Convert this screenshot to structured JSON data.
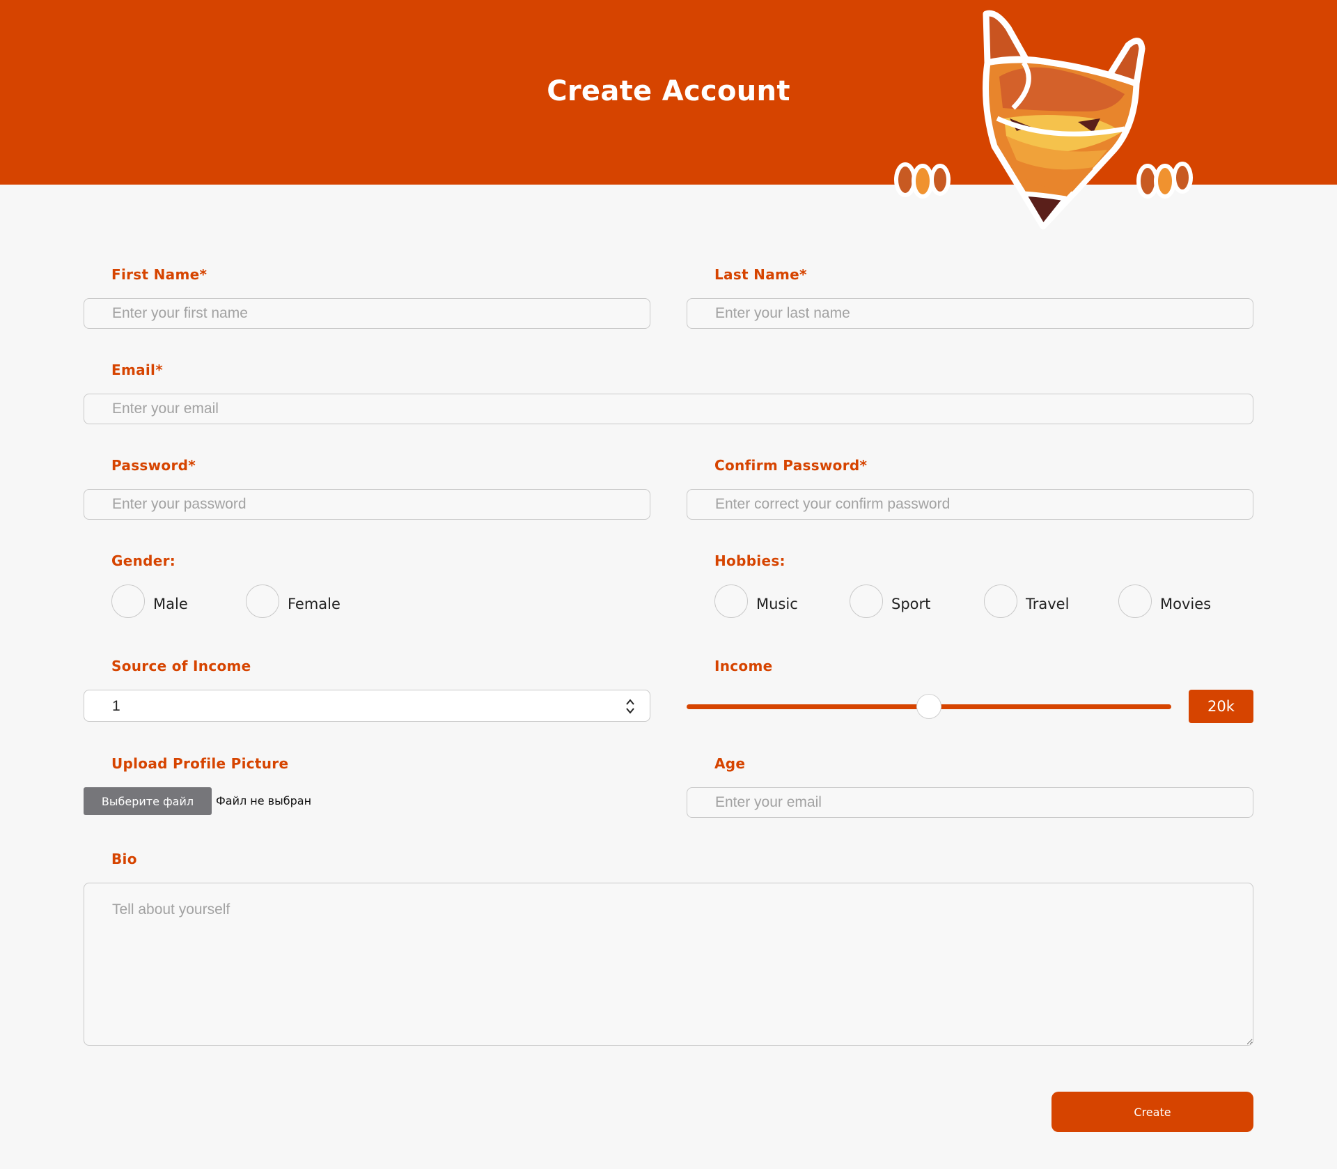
{
  "header": {
    "title": "Create Account"
  },
  "form": {
    "first_name": {
      "label": "First Name*",
      "placeholder": "Enter your first name"
    },
    "last_name": {
      "label": "Last Name*",
      "placeholder": "Enter your last name"
    },
    "email": {
      "label": "Email*",
      "placeholder": "Enter your email"
    },
    "password": {
      "label": "Password*",
      "placeholder": "Enter your password"
    },
    "confirm_password": {
      "label": "Confirm Password*",
      "placeholder": "Enter correct your confirm password"
    },
    "gender": {
      "label": "Gender:",
      "options": [
        "Male",
        "Female"
      ]
    },
    "hobbies": {
      "label": "Hobbies:",
      "options": [
        "Music",
        "Sport",
        "Travel",
        "Movies"
      ]
    },
    "source_of_income": {
      "label": "Source of Income",
      "value": "1"
    },
    "income": {
      "label": "Income",
      "value_label": "20k",
      "slider_fraction": 0.5
    },
    "upload": {
      "label": "Upload Profile Picture",
      "button_label": "Выберите файл",
      "status": "Файл не выбран"
    },
    "age": {
      "label": "Age",
      "placeholder": "Enter your email"
    },
    "bio": {
      "label": "Bio",
      "placeholder": "Tell about yourself"
    },
    "submit_label": "Create"
  },
  "colors": {
    "accent": "#d64400",
    "background": "#f7f7f7",
    "border": "#c9c9c9"
  },
  "icons": {
    "logo": "fox-mascot-icon",
    "select_chevron": "chevron-up-down-icon"
  }
}
